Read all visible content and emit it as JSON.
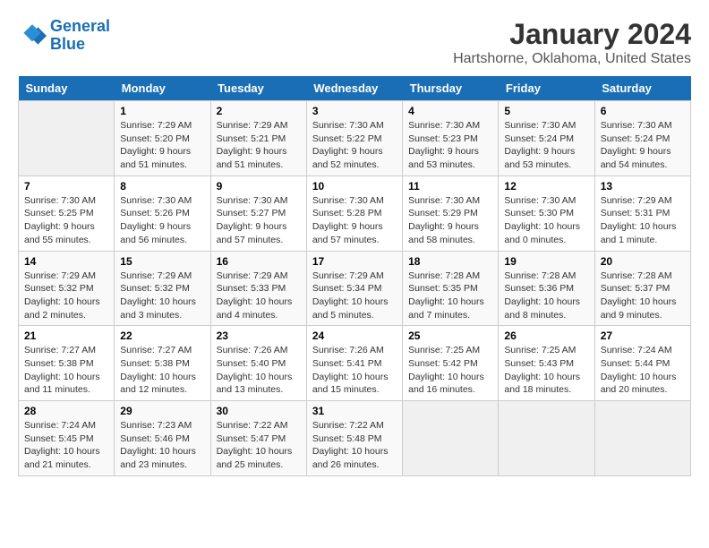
{
  "logo": {
    "line1": "General",
    "line2": "Blue"
  },
  "title": "January 2024",
  "subtitle": "Hartshorne, Oklahoma, United States",
  "weekdays": [
    "Sunday",
    "Monday",
    "Tuesday",
    "Wednesday",
    "Thursday",
    "Friday",
    "Saturday"
  ],
  "weeks": [
    [
      {
        "day": "",
        "info": ""
      },
      {
        "day": "1",
        "info": "Sunrise: 7:29 AM\nSunset: 5:20 PM\nDaylight: 9 hours\nand 51 minutes."
      },
      {
        "day": "2",
        "info": "Sunrise: 7:29 AM\nSunset: 5:21 PM\nDaylight: 9 hours\nand 51 minutes."
      },
      {
        "day": "3",
        "info": "Sunrise: 7:30 AM\nSunset: 5:22 PM\nDaylight: 9 hours\nand 52 minutes."
      },
      {
        "day": "4",
        "info": "Sunrise: 7:30 AM\nSunset: 5:23 PM\nDaylight: 9 hours\nand 53 minutes."
      },
      {
        "day": "5",
        "info": "Sunrise: 7:30 AM\nSunset: 5:24 PM\nDaylight: 9 hours\nand 53 minutes."
      },
      {
        "day": "6",
        "info": "Sunrise: 7:30 AM\nSunset: 5:24 PM\nDaylight: 9 hours\nand 54 minutes."
      }
    ],
    [
      {
        "day": "7",
        "info": "Sunrise: 7:30 AM\nSunset: 5:25 PM\nDaylight: 9 hours\nand 55 minutes."
      },
      {
        "day": "8",
        "info": "Sunrise: 7:30 AM\nSunset: 5:26 PM\nDaylight: 9 hours\nand 56 minutes."
      },
      {
        "day": "9",
        "info": "Sunrise: 7:30 AM\nSunset: 5:27 PM\nDaylight: 9 hours\nand 57 minutes."
      },
      {
        "day": "10",
        "info": "Sunrise: 7:30 AM\nSunset: 5:28 PM\nDaylight: 9 hours\nand 57 minutes."
      },
      {
        "day": "11",
        "info": "Sunrise: 7:30 AM\nSunset: 5:29 PM\nDaylight: 9 hours\nand 58 minutes."
      },
      {
        "day": "12",
        "info": "Sunrise: 7:30 AM\nSunset: 5:30 PM\nDaylight: 10 hours\nand 0 minutes."
      },
      {
        "day": "13",
        "info": "Sunrise: 7:29 AM\nSunset: 5:31 PM\nDaylight: 10 hours\nand 1 minute."
      }
    ],
    [
      {
        "day": "14",
        "info": "Sunrise: 7:29 AM\nSunset: 5:32 PM\nDaylight: 10 hours\nand 2 minutes."
      },
      {
        "day": "15",
        "info": "Sunrise: 7:29 AM\nSunset: 5:32 PM\nDaylight: 10 hours\nand 3 minutes."
      },
      {
        "day": "16",
        "info": "Sunrise: 7:29 AM\nSunset: 5:33 PM\nDaylight: 10 hours\nand 4 minutes."
      },
      {
        "day": "17",
        "info": "Sunrise: 7:29 AM\nSunset: 5:34 PM\nDaylight: 10 hours\nand 5 minutes."
      },
      {
        "day": "18",
        "info": "Sunrise: 7:28 AM\nSunset: 5:35 PM\nDaylight: 10 hours\nand 7 minutes."
      },
      {
        "day": "19",
        "info": "Sunrise: 7:28 AM\nSunset: 5:36 PM\nDaylight: 10 hours\nand 8 minutes."
      },
      {
        "day": "20",
        "info": "Sunrise: 7:28 AM\nSunset: 5:37 PM\nDaylight: 10 hours\nand 9 minutes."
      }
    ],
    [
      {
        "day": "21",
        "info": "Sunrise: 7:27 AM\nSunset: 5:38 PM\nDaylight: 10 hours\nand 11 minutes."
      },
      {
        "day": "22",
        "info": "Sunrise: 7:27 AM\nSunset: 5:38 PM\nDaylight: 10 hours\nand 12 minutes."
      },
      {
        "day": "23",
        "info": "Sunrise: 7:26 AM\nSunset: 5:40 PM\nDaylight: 10 hours\nand 13 minutes."
      },
      {
        "day": "24",
        "info": "Sunrise: 7:26 AM\nSunset: 5:41 PM\nDaylight: 10 hours\nand 15 minutes."
      },
      {
        "day": "25",
        "info": "Sunrise: 7:25 AM\nSunset: 5:42 PM\nDaylight: 10 hours\nand 16 minutes."
      },
      {
        "day": "26",
        "info": "Sunrise: 7:25 AM\nSunset: 5:43 PM\nDaylight: 10 hours\nand 18 minutes."
      },
      {
        "day": "27",
        "info": "Sunrise: 7:24 AM\nSunset: 5:44 PM\nDaylight: 10 hours\nand 20 minutes."
      }
    ],
    [
      {
        "day": "28",
        "info": "Sunrise: 7:24 AM\nSunset: 5:45 PM\nDaylight: 10 hours\nand 21 minutes."
      },
      {
        "day": "29",
        "info": "Sunrise: 7:23 AM\nSunset: 5:46 PM\nDaylight: 10 hours\nand 23 minutes."
      },
      {
        "day": "30",
        "info": "Sunrise: 7:22 AM\nSunset: 5:47 PM\nDaylight: 10 hours\nand 25 minutes."
      },
      {
        "day": "31",
        "info": "Sunrise: 7:22 AM\nSunset: 5:48 PM\nDaylight: 10 hours\nand 26 minutes."
      },
      {
        "day": "",
        "info": ""
      },
      {
        "day": "",
        "info": ""
      },
      {
        "day": "",
        "info": ""
      }
    ]
  ]
}
